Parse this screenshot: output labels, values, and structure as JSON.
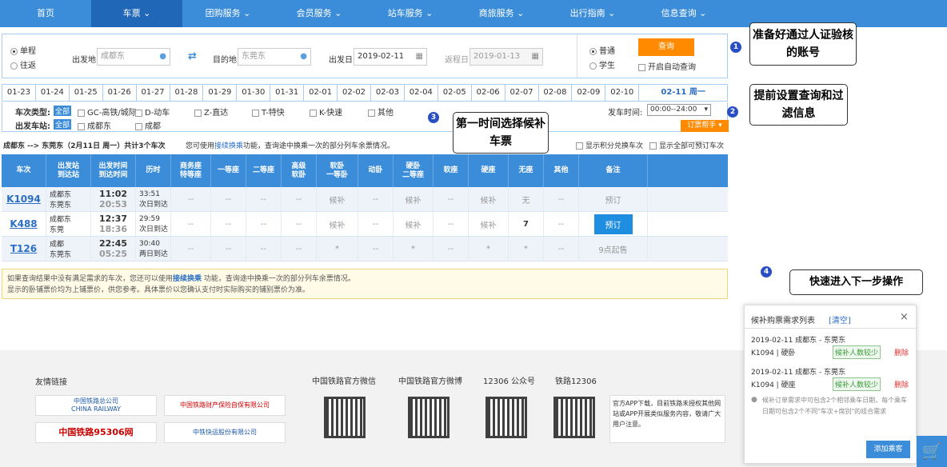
{
  "nav": [
    "首页",
    "车票",
    "团购服务",
    "会员服务",
    "站车服务",
    "商旅服务",
    "出行指南",
    "信息查询"
  ],
  "query": {
    "single": "单程",
    "round": "往返",
    "from_label": "出发地",
    "from_value": "成都东",
    "to_label": "目的地",
    "to_value": "东莞东",
    "date_label": "出发日",
    "date_value": "2019-02-11",
    "return_label": "返程日",
    "return_value": "2019-01-13",
    "normal": "普通",
    "student": "学生",
    "search": "查询",
    "auto": "开启自动查询"
  },
  "dates": [
    "01-23",
    "01-24",
    "01-25",
    "01-26",
    "01-27",
    "01-28",
    "01-29",
    "01-30",
    "01-31",
    "02-01",
    "02-02",
    "02-03",
    "02-04",
    "02-05",
    "02-06",
    "02-07",
    "02-08",
    "02-09",
    "02-10",
    "02-11 周一"
  ],
  "filter": {
    "type_label": "车次类型:",
    "all": "全部",
    "types": [
      "GC-高铁/城际",
      "D-动车",
      "Z-直达",
      "T-特快",
      "K-快速",
      "其他"
    ],
    "station_label": "出发车站:",
    "stations": [
      "成都东",
      "成都"
    ],
    "time_label": "发车时间:",
    "time_value": "00:00--24:00",
    "helper": "订票帮手"
  },
  "summary": {
    "route": "成都东 --> 东莞东（2月11日 周一）共计3个车次",
    "tip_pre": "您可使用",
    "tip_link": "接续换乘",
    "tip_post": "功能，查询途中换乘一次的部分列车余票情况。",
    "opt1": "显示积分兑换车次",
    "opt2": "显示全部可预订车次"
  },
  "headers": [
    "车次",
    "出发站\n到达站",
    "出发时间\n到达时间",
    "历时",
    "商务座\n特等座",
    "一等座",
    "二等座",
    "高级\n软卧",
    "软卧\n一等卧",
    "动卧",
    "硬卧\n二等座",
    "软座",
    "硬座",
    "无座",
    "其他",
    "备注"
  ],
  "trains": [
    {
      "no": "K1094",
      "from": "成都东",
      "to": "东莞东",
      "dep": "11:02",
      "arr": "20:53",
      "dur": "33:51",
      "day": "次日到达",
      "cells": [
        "--",
        "--",
        "--",
        "--",
        "候补",
        "--",
        "候补",
        "--",
        "候补",
        "无",
        "--"
      ],
      "action": "预订"
    },
    {
      "no": "K488",
      "from": "成都东",
      "to": "东莞",
      "dep": "12:37",
      "arr": "18:36",
      "dur": "29:59",
      "day": "次日到达",
      "cells": [
        "--",
        "--",
        "--",
        "--",
        "候补",
        "--",
        "候补",
        "--",
        "候补",
        "7",
        "--"
      ],
      "action": "预订"
    },
    {
      "no": "T126",
      "from": "成都",
      "to": "东莞东",
      "dep": "22:45",
      "arr": "05:25",
      "dur": "30:40",
      "day": "两日到达",
      "cells": [
        "--",
        "--",
        "--",
        "--",
        "*",
        "--",
        "*",
        "--",
        "*",
        "*",
        "--"
      ],
      "action": "9点起售"
    }
  ],
  "note": {
    "line1_pre": "如果查询结果中没有满足需求的车次，您还可以使用",
    "line1_link": "接续换乘",
    "line1_post": " 功能，查询途中换乘一次的部分列车余票情况。",
    "line2": "显示的卧铺票价均为上铺票价，供您参考。具体票价以您确认支付时实际购买的铺别票价为准。"
  },
  "callouts": {
    "c1": "准备好通过人证验核的账号",
    "c2": "提前设置查询和过滤信息",
    "c3": "第一时间选择候补车票",
    "c4": "快速进入下一步操作"
  },
  "footer": {
    "links_title": "友情链接",
    "l1": "中国铁路总公司",
    "l1en": "CHINA RAILWAY",
    "l2": "中国铁路财产保险自保有限公司",
    "l3": "中国铁路95306网",
    "l4": "中铁快运股份有限公司",
    "wechat": "中国铁路官方微信",
    "weibo": "中国铁路官方微博",
    "gzh": "12306 公众号",
    "app": "铁路12306",
    "notice": "官方APP下载，目前铁路未授权其他网站或APP开展类似服务内容，敬请广大用户注意。"
  },
  "panel": {
    "title": "候补购票需求列表",
    "clear": "[清空]",
    "items": [
      {
        "line": "2019-02-11 成都东 - 东莞东",
        "train": "K1094 | 硬卧",
        "status": "候补人数较少",
        "del": "删除"
      },
      {
        "line": "2019-02-11 成都东 - 东莞东",
        "train": "K1094 | 硬座",
        "status": "候补人数较少",
        "del": "删除"
      }
    ],
    "tip": "候补订单需求中可包含2个相邻乘车日期，每个乘车日期可包含2个不同\"车次+席别\"的组合需求",
    "add": "添加乘客"
  }
}
